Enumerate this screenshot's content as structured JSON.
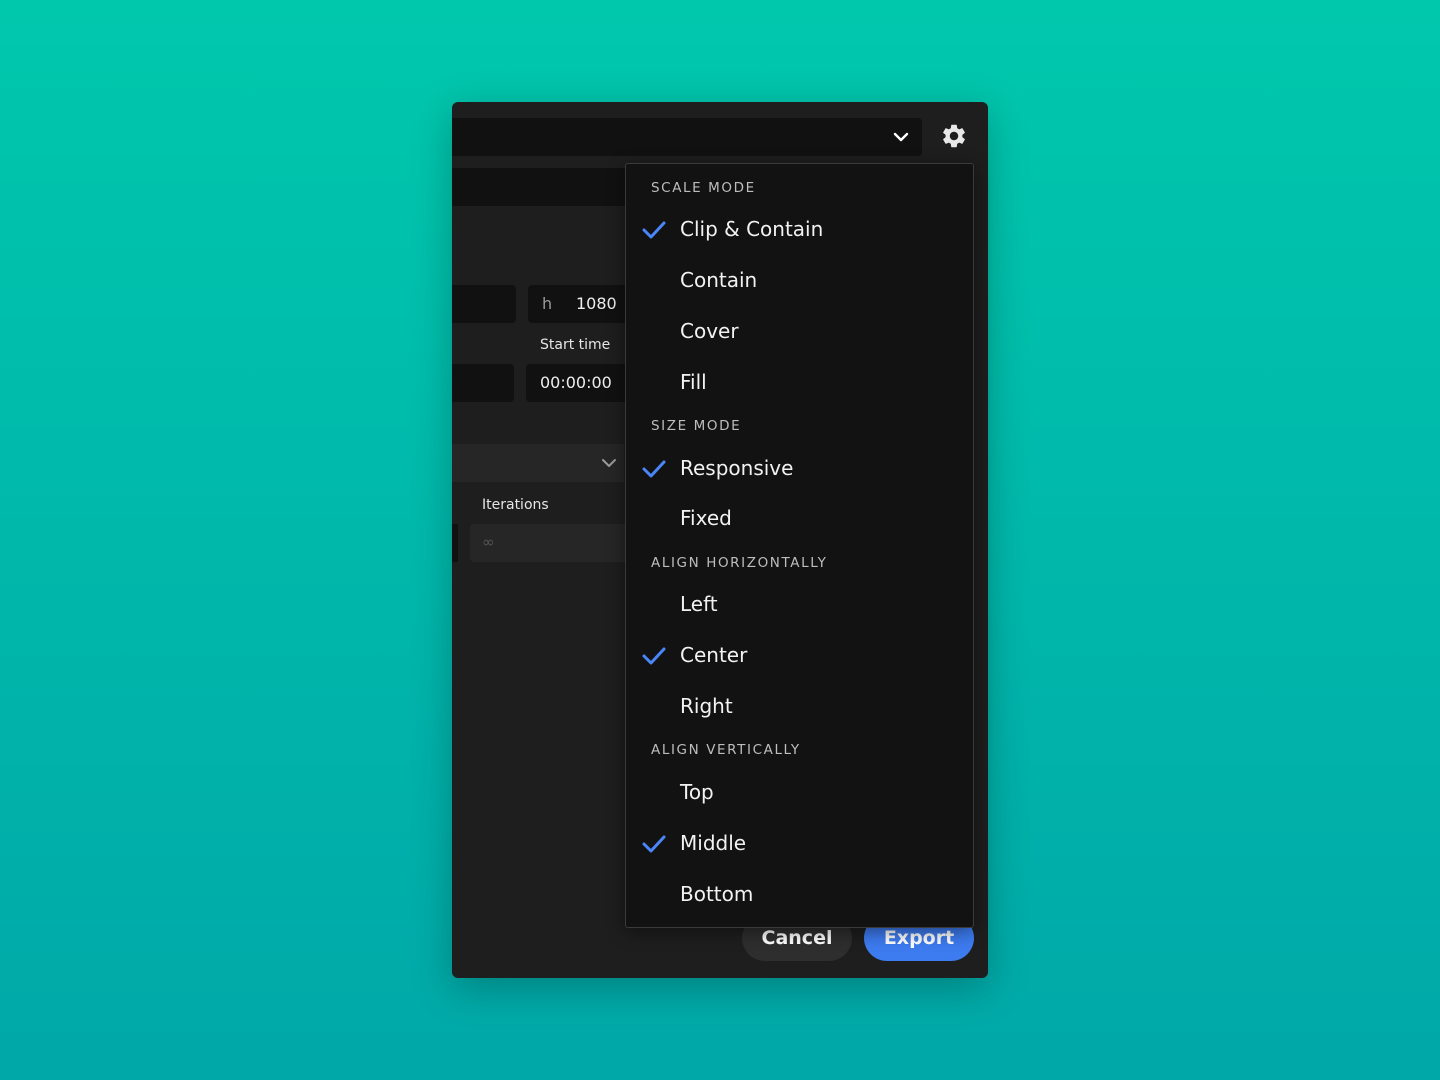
{
  "colors": {
    "accent": "#3d7bf0",
    "check": "#4a86f7",
    "menu_bg": "#121212",
    "panel_bg": "#1e1e1e"
  },
  "fields": {
    "h_label": "h",
    "h_value": "1080",
    "start_time_label": "Start time",
    "start_time_value": "00:00:00",
    "iterations_label": "Iterations",
    "iterations_placeholder": "∞"
  },
  "buttons": {
    "cancel": "Cancel",
    "export": "Export"
  },
  "menu": {
    "scale_mode": {
      "header": "SCALE MODE",
      "items": [
        {
          "label": "Clip & Contain",
          "checked": true
        },
        {
          "label": "Contain",
          "checked": false
        },
        {
          "label": "Cover",
          "checked": false
        },
        {
          "label": "Fill",
          "checked": false
        }
      ]
    },
    "size_mode": {
      "header": "SIZE MODE",
      "items": [
        {
          "label": "Responsive",
          "checked": true
        },
        {
          "label": "Fixed",
          "checked": false
        }
      ]
    },
    "align_horizontally": {
      "header": "ALIGN HORIZONTALLY",
      "items": [
        {
          "label": "Left",
          "checked": false
        },
        {
          "label": "Center",
          "checked": true
        },
        {
          "label": "Right",
          "checked": false
        }
      ]
    },
    "align_vertically": {
      "header": "ALIGN VERTICALLY",
      "items": [
        {
          "label": "Top",
          "checked": false
        },
        {
          "label": "Middle",
          "checked": true
        },
        {
          "label": "Bottom",
          "checked": false
        }
      ]
    }
  }
}
